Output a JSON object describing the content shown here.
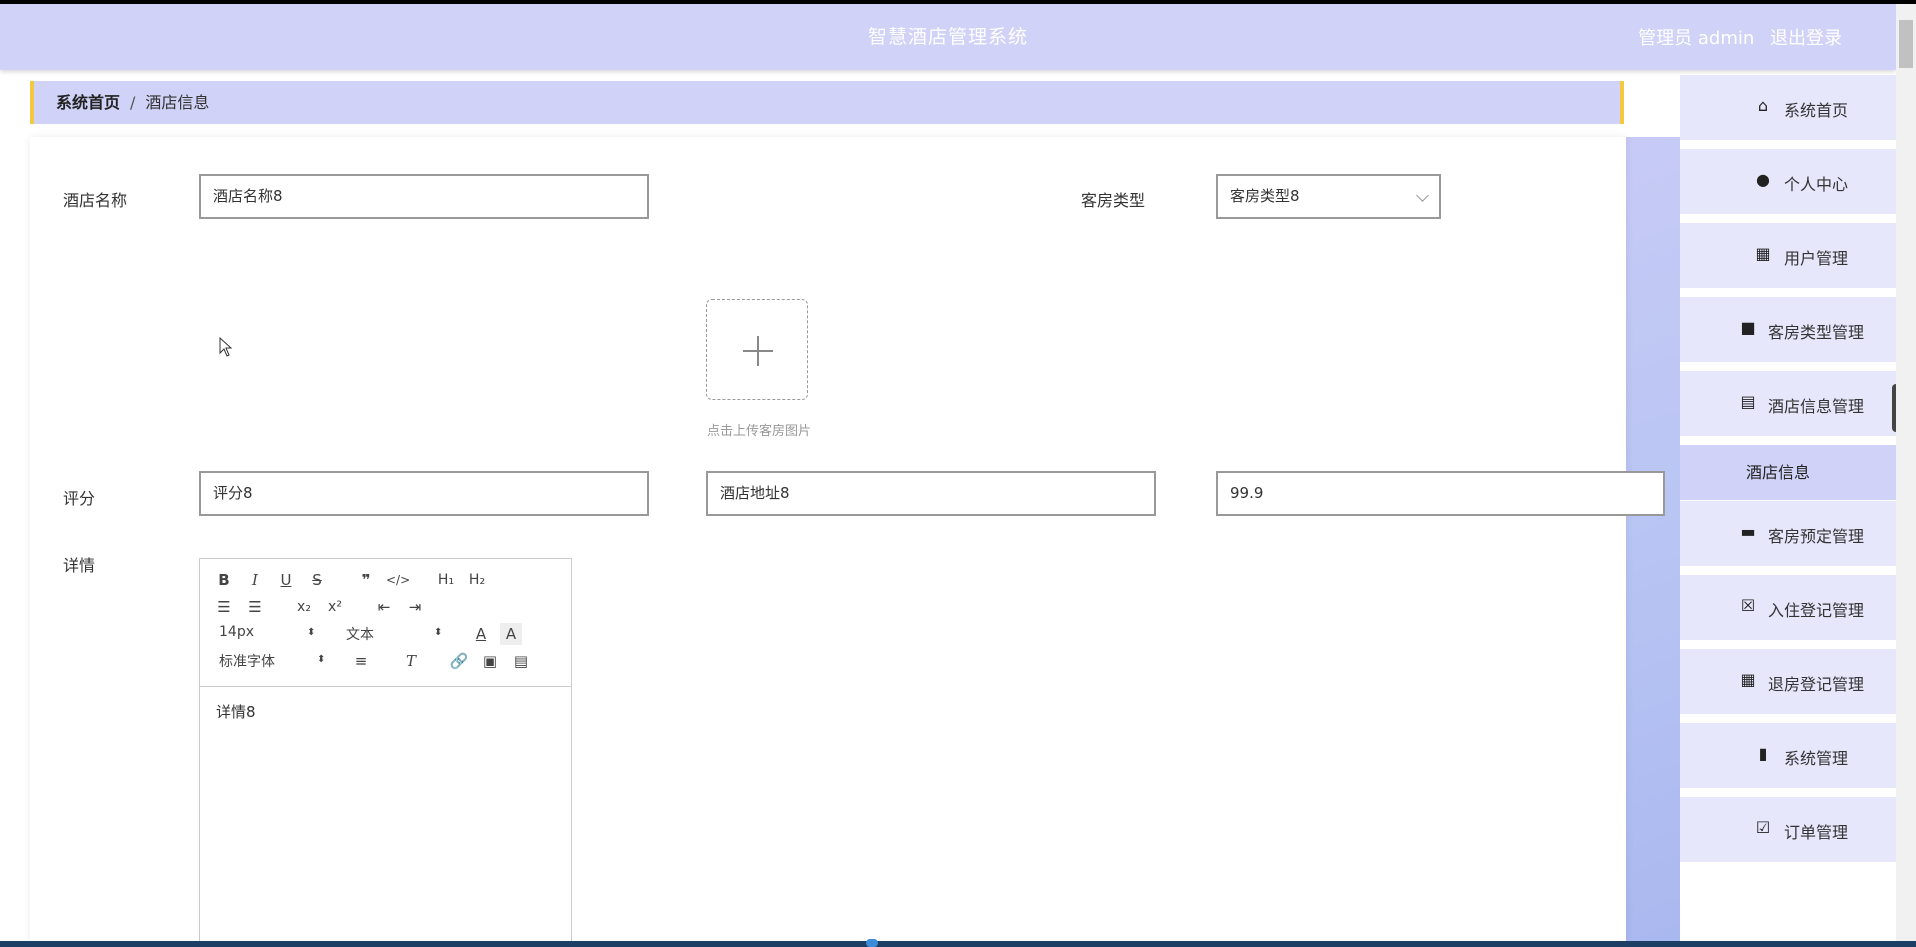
{
  "header": {
    "title": "智慧酒店管理系统",
    "user": "管理员 admin",
    "logout": "退出登录"
  },
  "breadcrumb": {
    "home": "系统首页",
    "separator": "/",
    "current": "酒店信息"
  },
  "form": {
    "hotel_name_label": "酒店名称",
    "hotel_name_value": "酒店名称8",
    "room_type_label": "客房类型",
    "room_type_value": "客房类型8",
    "upload_tip": "点击上传客房图片",
    "rating_label": "评分",
    "rating_value": "评分8",
    "address_value": "酒店地址8",
    "price_value": "99.9",
    "detail_label": "详情"
  },
  "editor": {
    "font_size": "14px",
    "header_select": "文本",
    "font_family": "标准字体",
    "content": "详情8"
  },
  "sidebar": {
    "items": [
      {
        "label": "系统首页",
        "icon": "home-icon"
      },
      {
        "label": "个人中心",
        "icon": "user-icon"
      },
      {
        "label": "用户管理",
        "icon": "grid-icon"
      },
      {
        "label": "客房类型管理",
        "icon": "briefcase-icon"
      },
      {
        "label": "酒店信息管理",
        "icon": "clipboard-icon"
      },
      {
        "label": "客房预定管理",
        "icon": "monitor-icon"
      },
      {
        "label": "入住登记管理",
        "icon": "clipboard-x-icon"
      },
      {
        "label": "退房登记管理",
        "icon": "grid-icon"
      },
      {
        "label": "系统管理",
        "icon": "bar-chart-icon"
      },
      {
        "label": "订单管理",
        "icon": "clipboard-check-icon"
      }
    ],
    "sub_item": "酒店信息"
  },
  "colors": {
    "header": "#d0d2f7",
    "accent": "#f5c842",
    "sidebar": "#e6e7fb"
  }
}
